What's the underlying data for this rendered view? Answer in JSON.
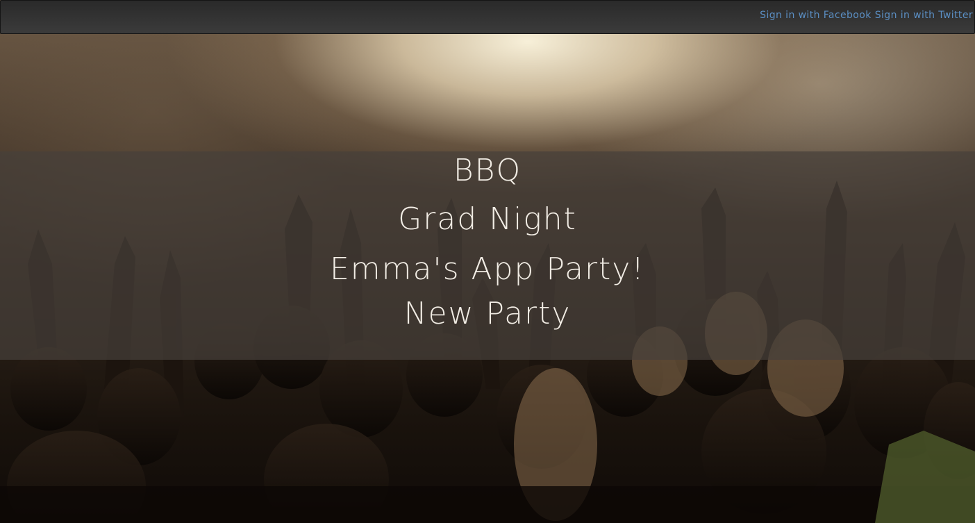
{
  "header": {
    "facebook_label": "Sign in with Facebook",
    "twitter_label": "Sign in with Twitter",
    "link_color": "#5b8fc4"
  },
  "parties": [
    {
      "title": "BBQ"
    },
    {
      "title": "Grad Night"
    },
    {
      "title": "Emma's App Party!"
    },
    {
      "title": "New Party"
    }
  ],
  "background": {
    "image": "concert-crowd-photo"
  }
}
